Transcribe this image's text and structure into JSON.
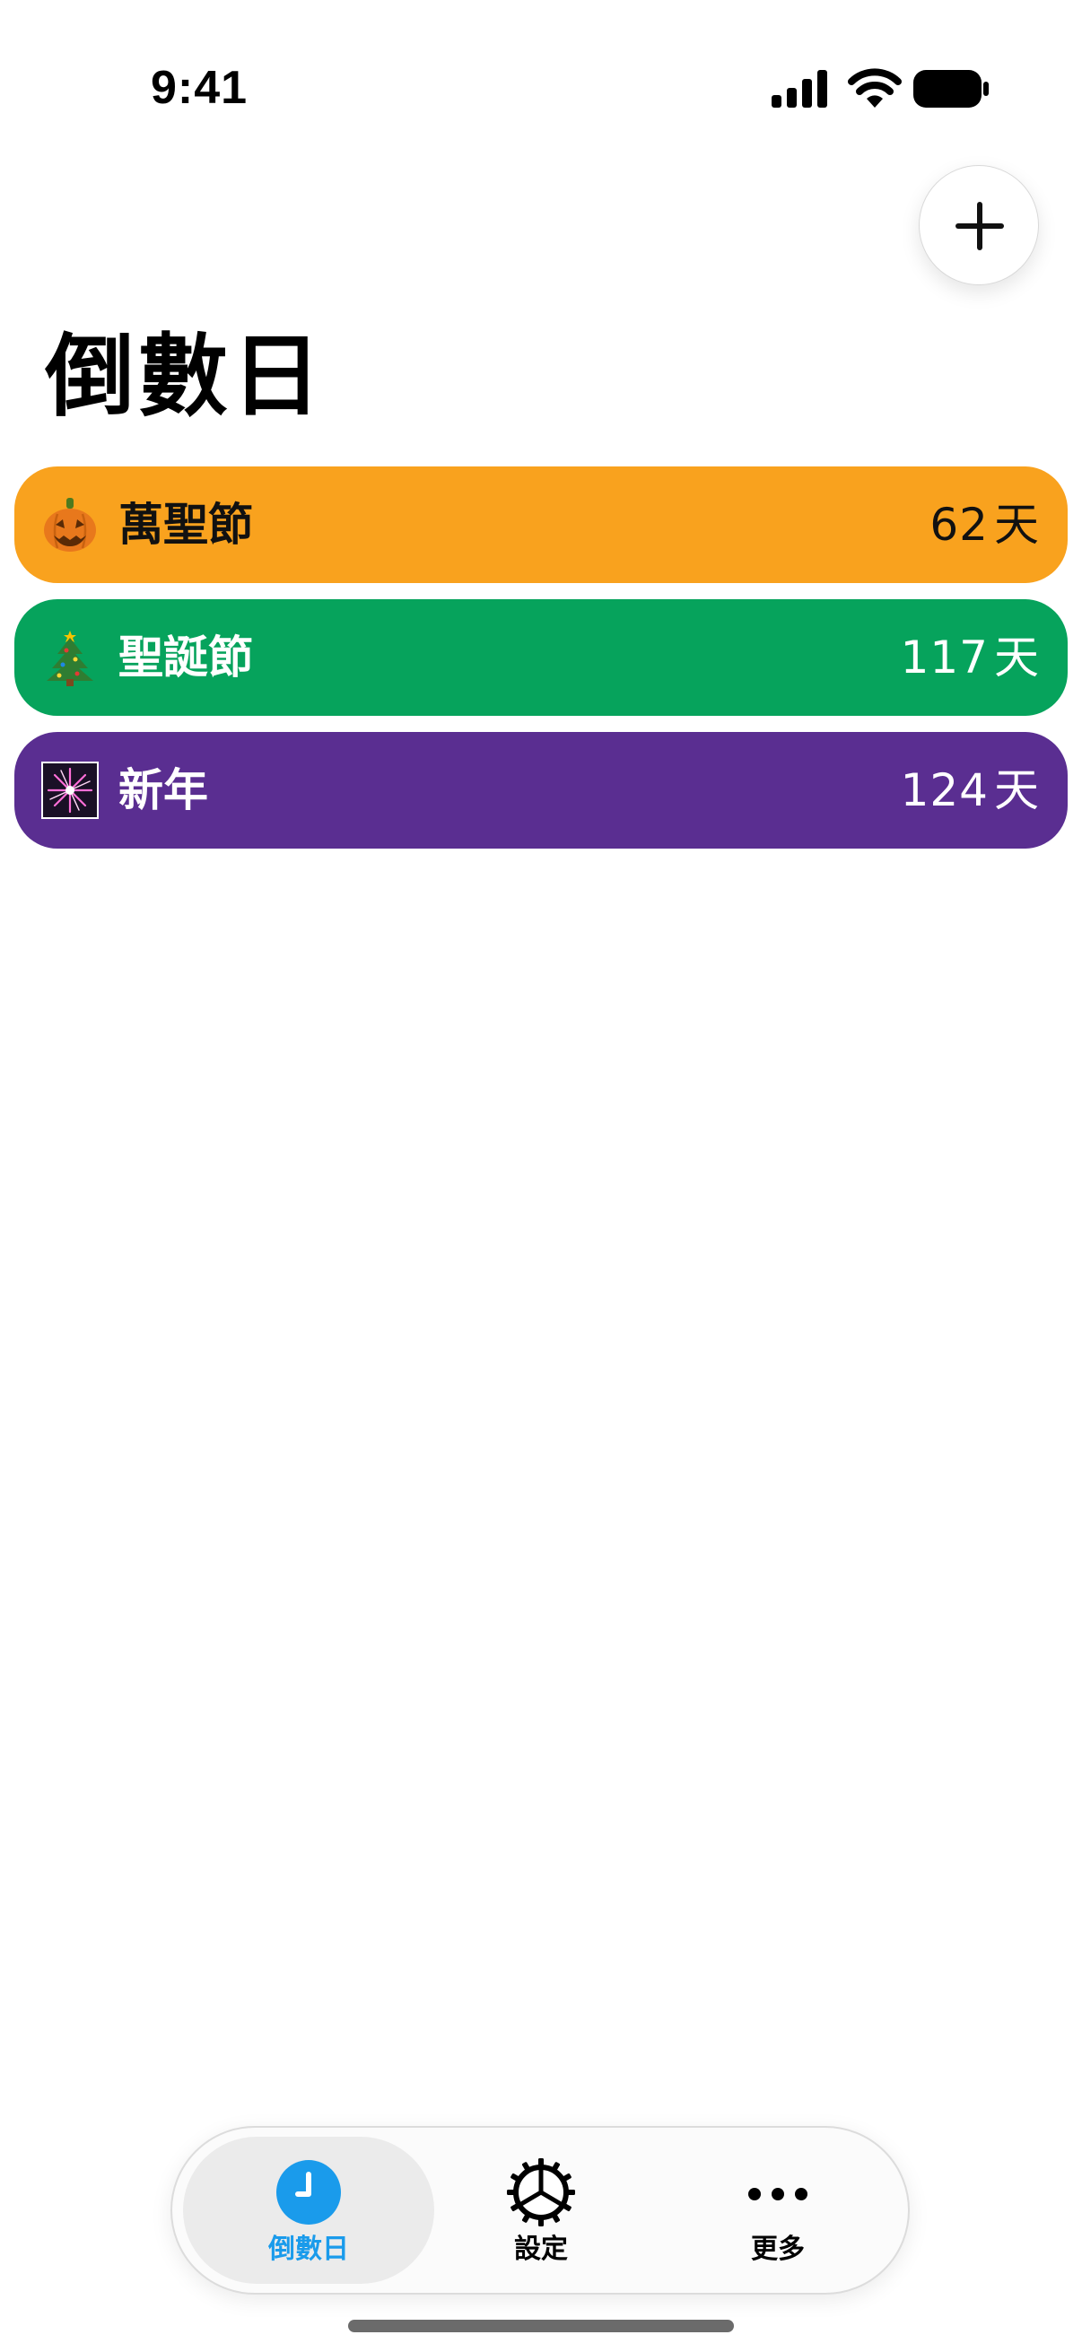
{
  "status_bar": {
    "time": "9:41",
    "icons": [
      "signal-icon",
      "wifi-icon",
      "battery-icon"
    ]
  },
  "header": {
    "add_button_icon": "plus-icon",
    "title": "倒數日"
  },
  "countdowns": [
    {
      "emoji": "pumpkin-icon",
      "name": "萬聖節",
      "days": "62",
      "unit": "天",
      "color": "#F9A21E",
      "text_color": "#111111"
    },
    {
      "emoji": "christmas-tree-icon",
      "name": "聖誕節",
      "days": "117",
      "unit": "天",
      "color": "#06A35C",
      "text_color": "#FFFFFF"
    },
    {
      "emoji": "firework-icon",
      "name": "新年",
      "days": "124",
      "unit": "天",
      "color": "#5A2E91",
      "text_color": "#FFFFFF"
    }
  ],
  "tab_bar": {
    "active_color": "#1A9BEB",
    "tabs": [
      {
        "label": "倒數日",
        "icon": "clock-icon",
        "active": true
      },
      {
        "label": "設定",
        "icon": "gear-icon",
        "active": false
      },
      {
        "label": "更多",
        "icon": "more-icon",
        "active": false
      }
    ]
  }
}
